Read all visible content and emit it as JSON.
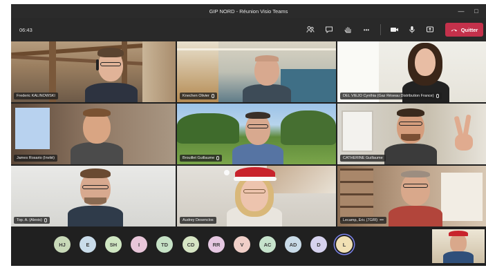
{
  "window": {
    "title": "GIP NORD - Réunion Visio Teams"
  },
  "toolbar": {
    "time": "06:43",
    "icons": [
      "participants-icon",
      "chat-icon",
      "raise-hand-icon",
      "more-icon",
      "camera-icon",
      "mic-icon",
      "share-icon",
      "phone-hangup-icon"
    ],
    "more_label": "•••",
    "leave_label": "Quitter"
  },
  "participants": [
    {
      "name": "Frederic KALINOWSKI",
      "mic": false
    },
    {
      "name": "Knechen Olivier",
      "mic": true
    },
    {
      "name": "DEL VIEJO Cynthia (Gaz Réseau Distribution France)",
      "mic": true
    },
    {
      "name": "James Rosario (Invité)",
      "mic": false
    },
    {
      "name": "Brouillet Guillaume",
      "mic": true
    },
    {
      "name": "CATHERINE Guillaume",
      "mic": false
    },
    {
      "name": "Top. A. (Alexis)",
      "mic": true
    },
    {
      "name": "Audrey Desenclos",
      "mic": false
    },
    {
      "name": "Lecamp, Eric (7GRI)",
      "mic": false,
      "extra": "•••"
    }
  ],
  "roster": [
    {
      "initials": "HJ",
      "color": "#c8d9b8"
    },
    {
      "initials": "E",
      "color": "#c9dcea"
    },
    {
      "initials": "SH",
      "color": "#cfe6c2"
    },
    {
      "initials": "I",
      "color": "#e8c6d9"
    },
    {
      "initials": "TD",
      "color": "#c6e2c6"
    },
    {
      "initials": "CD",
      "color": "#d6e5c4"
    },
    {
      "initials": "RR",
      "color": "#e6c8e2"
    },
    {
      "initials": "V",
      "color": "#f0cfc8"
    },
    {
      "initials": "AC",
      "color": "#c6e3cc"
    },
    {
      "initials": "AD",
      "color": "#c9dbe8"
    },
    {
      "initials": "D",
      "color": "#d6d2ee"
    },
    {
      "initials": "L",
      "color": "#f1e0b4",
      "active": true
    }
  ],
  "colors": {
    "leave": "#c4314b",
    "background": "#1f1f1f",
    "active_ring": "#7b83eb"
  }
}
